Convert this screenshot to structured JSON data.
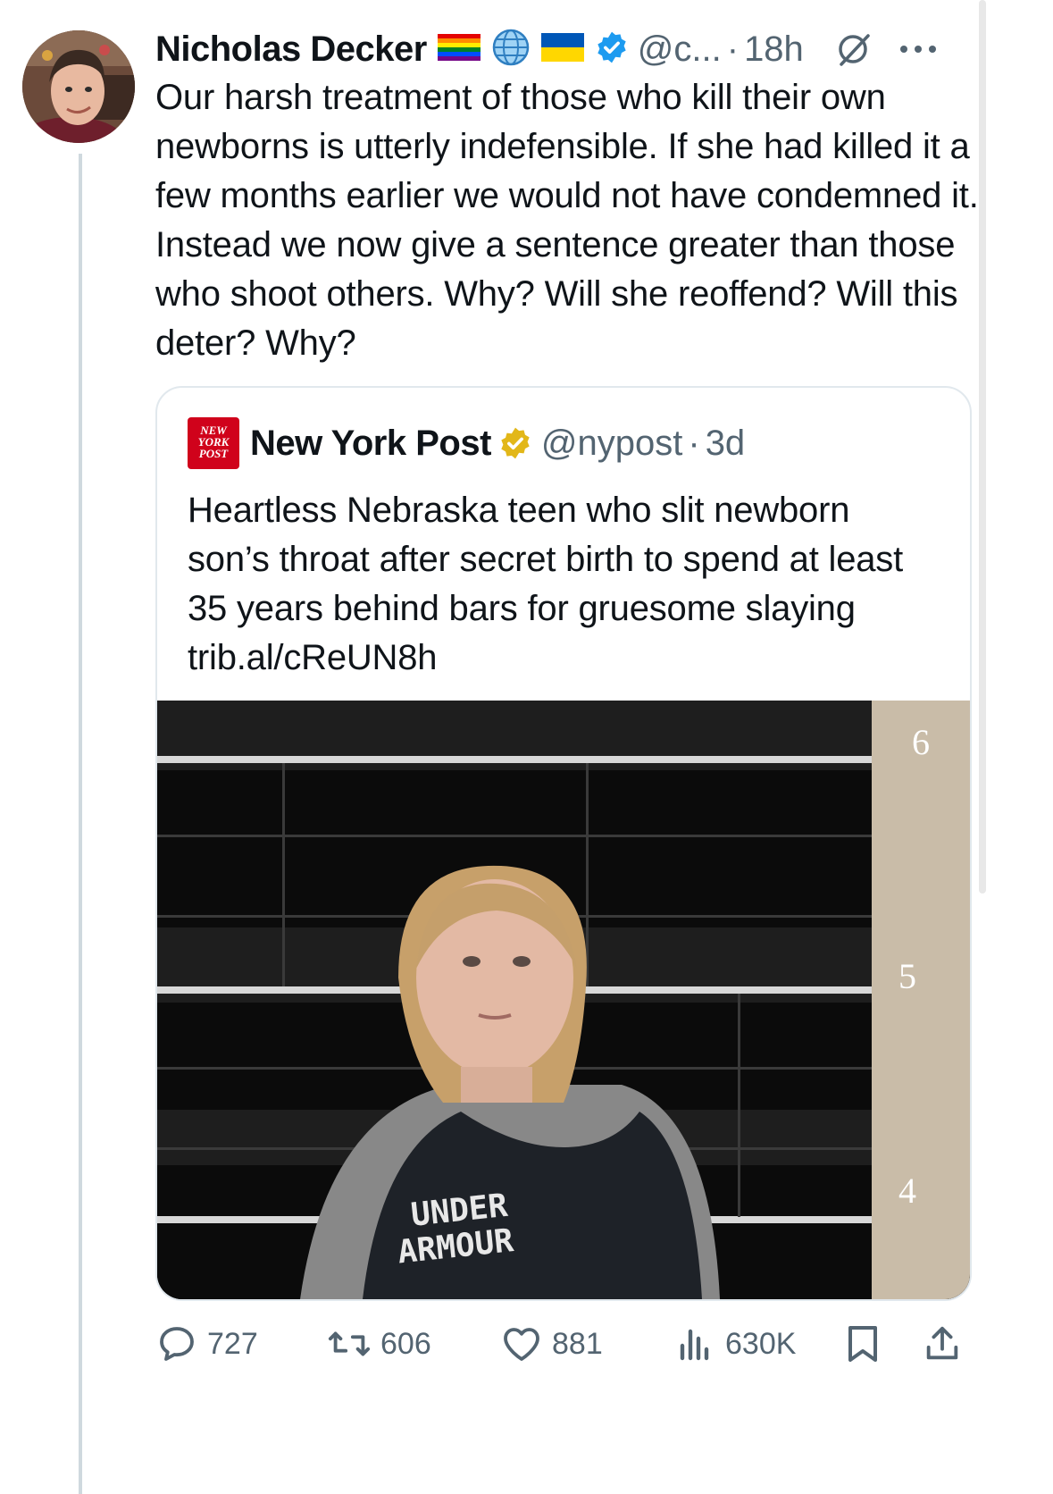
{
  "author": {
    "name": "Nicholas Decker",
    "handle": "@c...",
    "time": "18h",
    "badges": [
      "rainbow-flag-icon",
      "globe-icon",
      "ukraine-flag-icon",
      "verified-badge-icon"
    ]
  },
  "tweet": {
    "text": "Our harsh treatment of those who kill their own newborns is utterly indefensible. If she had killed it a few months earlier we would not have condemned it. Instead we now give a sentence greater than those who shoot others. Why? Will she reoffend? Will this deter? Why?"
  },
  "quoted": {
    "logo_text": [
      "NEW",
      "YORK",
      "POST"
    ],
    "name": "New York Post",
    "handle": "@nypost",
    "time": "3d",
    "text": "Heartless Nebraska teen who slit newborn son’s throat after secret birth to spend at least 35 years behind bars for gruesome slaying trib.al/cReUN8h",
    "image": {
      "height_marks": [
        "6",
        "5",
        "4"
      ],
      "shirt_text": [
        "UNDER",
        "ARMOUR"
      ]
    }
  },
  "actions": {
    "replies": "727",
    "reposts": "606",
    "likes": "881",
    "views": "630K"
  },
  "colors": {
    "verified_blue": "#1d9bf0",
    "verified_gold": "#e2b719",
    "nypost_red": "#d0021b",
    "secondary_text": "#536471"
  }
}
